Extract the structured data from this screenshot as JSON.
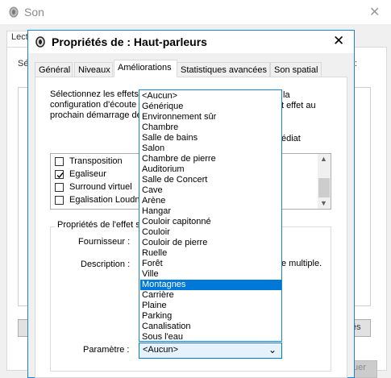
{
  "background_window": {
    "title": "Son",
    "tab_label": "Lect",
    "left_label": "Sé",
    "right_colon": ":",
    "button_right_label": "és",
    "quit_label": "uer"
  },
  "dialog": {
    "title": "Propriétés de : Haut-parleurs",
    "tabs": [
      {
        "label": "Général"
      },
      {
        "label": "Niveaux"
      },
      {
        "label": "Améliorations"
      },
      {
        "label": "Statistiques avancées"
      },
      {
        "label": "Son spatial"
      }
    ],
    "active_tab": "Améliorations",
    "intro_lines": [
      "Sélectionnez les effets",
      "configuration d'écoute",
      "prochain démarrage de"
    ],
    "intro_tails": [
      "la",
      "t effet au"
    ],
    "immediate_tail": "édiat",
    "effects": [
      {
        "label": "Transposition",
        "checked": false
      },
      {
        "label": "Egaliseur",
        "checked": true
      },
      {
        "label": "Surround virtuel",
        "checked": false
      },
      {
        "label": "Egalisation Loudne",
        "checked": false
      }
    ],
    "properties_legend": "Propriétés de l'effet s",
    "provider_label": "Fournisseur :",
    "description_label": "Description :",
    "description_tail": "e multiple.",
    "parameter_label": "Paramètre :",
    "parameter_value": "<Aucun>",
    "dropdown_options": [
      "<Aucun>",
      "Générique",
      "Environnement sûr",
      "Chambre",
      "Salle de bains",
      "Salon",
      "Chambre de pierre",
      "Auditorium",
      "Salle de Concert",
      "Cave",
      "Arène",
      "Hangar",
      "Couloir capitonné",
      "Couloir",
      "Couloir de pierre",
      "Ruelle",
      "Forêt",
      "Ville",
      "Montagnes",
      "Carrière",
      "Plaine",
      "Parking",
      "Canalisation",
      "Sous l'eau"
    ],
    "highlighted_option": "Montagnes"
  },
  "colors": {
    "accent": "#0078d7",
    "border_accent": "#1883d7"
  }
}
